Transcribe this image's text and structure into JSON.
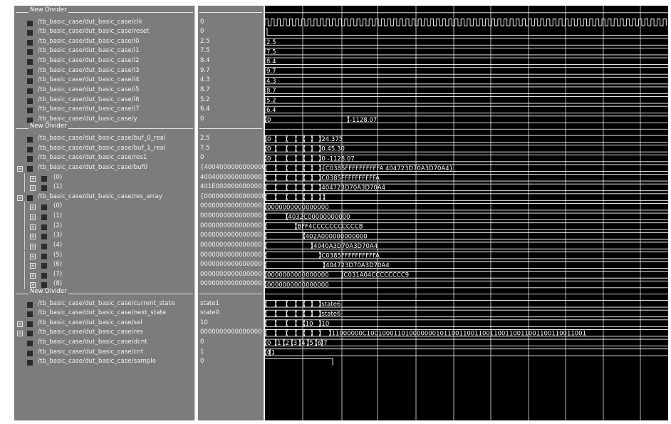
{
  "signals": [
    {
      "kind": "divider",
      "label": "New Divider"
    },
    {
      "kind": "signal",
      "name": "/tb_basic_case/dut_basic_case/clk",
      "value": "0",
      "wave": "clock"
    },
    {
      "kind": "signal",
      "name": "/tb_basic_case/dut_basic_case/reset",
      "value": "0",
      "wave": "reset"
    },
    {
      "kind": "signal",
      "name": "/tb_basic_case/dut_basic_case/i0",
      "value": "2.5",
      "wave": "const",
      "wave_text": "2.5"
    },
    {
      "kind": "signal",
      "name": "/tb_basic_case/dut_basic_case/i1",
      "value": "7.5",
      "wave": "const",
      "wave_text": "7.5"
    },
    {
      "kind": "signal",
      "name": "/tb_basic_case/dut_basic_case/i2",
      "value": "8.4",
      "wave": "const",
      "wave_text": "8.4"
    },
    {
      "kind": "signal",
      "name": "/tb_basic_case/dut_basic_case/i3",
      "value": "9.7",
      "wave": "const",
      "wave_text": "9.7"
    },
    {
      "kind": "signal",
      "name": "/tb_basic_case/dut_basic_case/i4",
      "value": "4.3",
      "wave": "const",
      "wave_text": "4.3"
    },
    {
      "kind": "signal",
      "name": "/tb_basic_case/dut_basic_case/i5",
      "value": "8.7",
      "wave": "const",
      "wave_text": "8.7"
    },
    {
      "kind": "signal",
      "name": "/tb_basic_case/dut_basic_case/i6",
      "value": "5.2",
      "wave": "const",
      "wave_text": "5.2"
    },
    {
      "kind": "signal",
      "name": "/tb_basic_case/dut_basic_case/i7",
      "value": "6.4",
      "wave": "const",
      "wave_text": "6.4"
    },
    {
      "kind": "signal",
      "name": "/tb_basic_case/dut_basic_case/y",
      "value": "0",
      "wave": "bus",
      "transitions": [
        0,
        0.205
      ],
      "labels": [
        "0",
        "-1128.07"
      ]
    },
    {
      "kind": "divider",
      "label": "New Divider"
    },
    {
      "kind": "signal",
      "name": "/tb_basic_case/dut_basic_case/buf_0_real",
      "value": "2.5",
      "wave": "bus",
      "transitions": [
        0,
        0.025,
        0.052,
        0.075,
        0.095,
        0.115,
        0.135
      ],
      "labels": [
        "0",
        "",
        "",
        "",
        "",
        "",
        "24.375"
      ]
    },
    {
      "kind": "signal",
      "name": "/tb_basic_case/dut_basic_case/buf_1_real",
      "value": "7.5",
      "wave": "bus",
      "transitions": [
        0,
        0.025,
        0.052,
        0.075,
        0.095,
        0.115,
        0.135
      ],
      "labels": [
        "0",
        "",
        "",
        "",
        "",
        "",
        "0.45.30"
      ]
    },
    {
      "kind": "signal",
      "name": "/tb_basic_case/dut_basic_case/res1",
      "value": "0",
      "wave": "bus",
      "transitions": [
        0,
        0.025,
        0.052,
        0.075,
        0.095,
        0.115,
        0.135
      ],
      "labels": [
        "0",
        "",
        "",
        "",
        "",
        "",
        "0 -1128.07"
      ]
    },
    {
      "kind": "group",
      "name": "/tb_basic_case/dut_basic_case/buf0",
      "value": "{4004000000000000}",
      "wave": "bus",
      "transitions": [
        0,
        0.025,
        0.052,
        0.075,
        0.095,
        0.115,
        0.135
      ],
      "labels": [
        "",
        "",
        "",
        "",
        "",
        "",
        "{C0385FFFFFFFFFFA 404723D70A3D70A4}"
      ]
    },
    {
      "kind": "sub",
      "name": "(0)",
      "value": "4004000000000000",
      "wave": "bus",
      "transitions": [
        0,
        0.025,
        0.052,
        0.075,
        0.095,
        0.115,
        0.135
      ],
      "labels": [
        "",
        "",
        "",
        "",
        "",
        "",
        "C0385FFFFFFFFFFA"
      ]
    },
    {
      "kind": "sub",
      "name": "(1)",
      "value": "401E000000000000",
      "wave": "bus",
      "transitions": [
        0,
        0.025,
        0.052,
        0.075,
        0.095,
        0.115,
        0.135
      ],
      "labels": [
        "",
        "",
        "",
        "",
        "",
        "",
        "404723D70A3D70A4"
      ]
    },
    {
      "kind": "group",
      "name": "/tb_basic_case/dut_basic_case/res_array",
      "value": "{0000000000000000}",
      "wave": "bus",
      "transitions": [
        0,
        0.025,
        0.052,
        0.075,
        0.095,
        0.115,
        0.135,
        0.145
      ],
      "labels": [
        "",
        "",
        "",
        "",
        "",
        "",
        "",
        ""
      ]
    },
    {
      "kind": "sub",
      "name": "(0)",
      "value": "0000000000000000",
      "wave": "bus",
      "transitions": [
        0
      ],
      "labels": [
        "0000000000000000"
      ]
    },
    {
      "kind": "sub",
      "name": "(1)",
      "value": "0000000000000000",
      "wave": "bus",
      "transitions": [
        0,
        0.052
      ],
      "labels": [
        "",
        "4032C00000000000"
      ]
    },
    {
      "kind": "sub",
      "name": "(2)",
      "value": "0000000000000000",
      "wave": "bus",
      "transitions": [
        0,
        0.075
      ],
      "labels": [
        "",
        "BFF4CCCCCCCCCCCB"
      ]
    },
    {
      "kind": "sub",
      "name": "(3)",
      "value": "0000000000000000",
      "wave": "bus",
      "transitions": [
        0,
        0.095
      ],
      "labels": [
        "",
        "402A000000000000"
      ]
    },
    {
      "kind": "sub",
      "name": "(4)",
      "value": "0000000000000000",
      "wave": "bus",
      "transitions": [
        0,
        0.115
      ],
      "labels": [
        "",
        "4040A3D70A3D70A4"
      ]
    },
    {
      "kind": "sub",
      "name": "(5)",
      "value": "0000000000000000",
      "wave": "bus",
      "transitions": [
        0,
        0.135
      ],
      "labels": [
        "",
        "C0385FFFFFFFFFFA"
      ]
    },
    {
      "kind": "sub",
      "name": "(6)",
      "value": "0000000000000000",
      "wave": "bus",
      "transitions": [
        0,
        0.145
      ],
      "labels": [
        "",
        "404723D70A3D70A4"
      ]
    },
    {
      "kind": "sub",
      "name": "(7)",
      "value": "0000000000000000",
      "wave": "bus",
      "transitions": [
        0,
        0.19
      ],
      "labels": [
        "0000000000000000",
        "C031A04CCCCCCCC9"
      ]
    },
    {
      "kind": "sub",
      "name": "(8)",
      "value": "0000000000000000",
      "wave": "bus",
      "transitions": [
        0
      ],
      "labels": [
        "0000000000000000"
      ]
    },
    {
      "kind": "divider",
      "label": "New Divider"
    },
    {
      "kind": "signal",
      "name": "/tb_basic_case/dut_basic_case/current_state",
      "value": "state1",
      "wave": "bus",
      "transitions": [
        0,
        0.025,
        0.052,
        0.075,
        0.095,
        0.115,
        0.135
      ],
      "labels": [
        "",
        "",
        "",
        "",
        "",
        "",
        "state6"
      ]
    },
    {
      "kind": "signal",
      "name": "/tb_basic_case/dut_basic_case/next_state",
      "value": "state0",
      "wave": "bus",
      "transitions": [
        0,
        0.025,
        0.052,
        0.075,
        0.095,
        0.115,
        0.135
      ],
      "labels": [
        "",
        "",
        "",
        "",
        "",
        "",
        "state6"
      ]
    },
    {
      "kind": "group",
      "name": "/tb_basic_case/dut_basic_case/sel",
      "value": "10",
      "wave": "bus",
      "transitions": [
        0,
        0.025,
        0.052,
        0.075,
        0.095,
        0.135
      ],
      "labels": [
        "",
        "",
        "",
        "",
        "10",
        "10"
      ]
    },
    {
      "kind": "group",
      "name": "/tb_basic_case/dut_basic_case/res",
      "value": "0000000000000000",
      "wave": "bus",
      "transitions": [
        0,
        0.025,
        0.052,
        0.075,
        0.095,
        0.115,
        0.135,
        0.16
      ],
      "labels": [
        "",
        "",
        "",
        "",
        "",
        "",
        "",
        "11000000C100100011010000000101100110011001100110011001100110011001"
      ]
    },
    {
      "kind": "signal",
      "name": "/tb_basic_case/dut_basic_case/dcnt",
      "value": "0",
      "wave": "bus",
      "transitions": [
        0,
        0.025,
        0.045,
        0.065,
        0.085,
        0.105,
        0.125,
        0.14
      ],
      "labels": [
        "0",
        "1",
        "2",
        "3",
        "4",
        "5",
        "6",
        "7"
      ]
    },
    {
      "kind": "signal",
      "name": "/tb_basic_case/dut_basic_case/cnt",
      "value": "1",
      "wave": "bus",
      "transitions": [
        0,
        0.01
      ],
      "labels": [
        "0",
        "1"
      ]
    },
    {
      "kind": "signal",
      "name": "/tb_basic_case/dut_basic_case/sample",
      "value": "0",
      "wave": "sample"
    }
  ],
  "colors": {
    "wave": "#ffffff",
    "grid": "#ffffff",
    "panel": "#7c7c7c",
    "background": "#000000"
  }
}
